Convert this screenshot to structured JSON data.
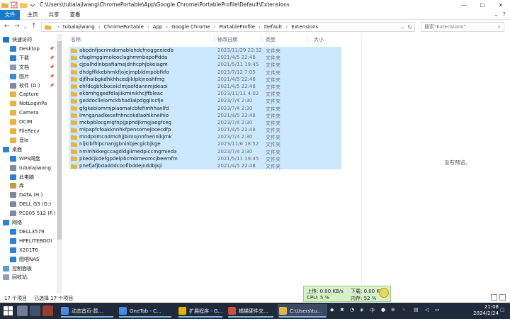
{
  "window": {
    "title": "C:\\Users\\tubalajiwang\\ChromePortable\\App\\Google Chrome\\PortableProfile\\Default\\Extensions"
  },
  "ribbon": {
    "tabs": [
      "文件",
      "主页",
      "共享",
      "查看"
    ]
  },
  "address": {
    "breadcrumbs": [
      "tubalajiwang",
      "ChromePortable",
      "App",
      "Google Chrome",
      "PortableProfile",
      "Default",
      "Extensions"
    ],
    "search_placeholder": "搜索\"Extensions\""
  },
  "sidebar": {
    "items": [
      {
        "label": "快速访问",
        "icon": "star-icon",
        "pinned": false
      },
      {
        "label": "Desktop",
        "icon": "desktop-icon",
        "pinned": true
      },
      {
        "label": "下载",
        "icon": "download-icon",
        "pinned": true
      },
      {
        "label": "文档",
        "icon": "document-icon",
        "pinned": true
      },
      {
        "label": "图片",
        "icon": "picture-icon",
        "pinned": true
      },
      {
        "label": "软件 (D:)",
        "icon": "drive-icon",
        "pinned": true
      },
      {
        "label": "Capture",
        "icon": "folder-icon",
        "pinned": false
      },
      {
        "label": "NotLoginPa",
        "icon": "folder-icon",
        "pinned": false
      },
      {
        "label": "Camera",
        "icon": "folder-icon",
        "pinned": false
      },
      {
        "label": "DCIM",
        "icon": "folder-icon",
        "pinned": false
      },
      {
        "label": "FileRecv",
        "icon": "folder-icon",
        "pinned": false
      },
      {
        "label": "音le",
        "icon": "folder-icon",
        "pinned": false
      },
      {
        "label": "桌面",
        "icon": "desktop-icon",
        "pinned": false
      },
      {
        "label": "WPS网盘",
        "icon": "cloud-icon",
        "pinned": false
      },
      {
        "label": "tubalajiwang",
        "icon": "user-icon",
        "pinned": false
      },
      {
        "label": "此电脑",
        "icon": "computer-icon",
        "pinned": false
      },
      {
        "label": "库",
        "icon": "library-icon",
        "pinned": false
      },
      {
        "label": "DATA (H:)",
        "icon": "drive-icon",
        "pinned": false
      },
      {
        "label": "DELL G3 (G:)",
        "icon": "drive-icon",
        "pinned": false
      },
      {
        "label": "PC005 512 (F:)",
        "icon": "drive-icon",
        "pinned": false
      },
      {
        "label": "网络",
        "icon": "network-icon",
        "pinned": false
      },
      {
        "label": "DELL3579",
        "icon": "computer-icon",
        "pinned": false
      },
      {
        "label": "HPELITEBOOI",
        "icon": "computer-icon",
        "pinned": false
      },
      {
        "label": "X201T6",
        "icon": "computer-icon",
        "pinned": false
      },
      {
        "label": "图吧NAS",
        "icon": "computer-icon",
        "pinned": false
      },
      {
        "label": "控制面板",
        "icon": "control-panel-icon",
        "pinned": false
      },
      {
        "label": "回收站",
        "icon": "recycle-bin-icon",
        "pinned": false
      }
    ]
  },
  "list": {
    "columns": {
      "name": "名称",
      "date": "修改日期",
      "type": "类型",
      "size": "大小"
    },
    "rows": [
      {
        "name": "abpdnfjocnmdomablahdcfnoggeeiedb",
        "date": "2023/11/29 22:32",
        "type": "文件夹"
      },
      {
        "name": "cfaglmggimoleoclaghmmbopoffdda",
        "date": "2021/4/5 22:48",
        "type": "文件夹"
      },
      {
        "name": "cjpalhdlnbpafiamejdnhcphjbkeiagm",
        "date": "2021/5/11 19:45",
        "type": "文件夹"
      },
      {
        "name": "dhdgffkkebhmkfjojejmpbldmpobfkfo",
        "date": "2023/7/12 7:05",
        "type": "文件夹"
      },
      {
        "name": "djflhoibgkdhkhhcedjiklpkjnoahfmg",
        "date": "2021/4/5 22:48",
        "type": "文件夹"
      },
      {
        "name": "ehfdcgbfcboceiclmjaofdannmjdeaoi",
        "date": "2021/4/5 22:48",
        "type": "文件夹"
      },
      {
        "name": "ekbmhggedfdlajiikminikhcjffbleac",
        "date": "2023/11/11 4:02",
        "type": "文件夹"
      },
      {
        "name": "geddoclleiomckbhadiaipdggiiccfje",
        "date": "2023/7/4 2:30",
        "type": "文件夹"
      },
      {
        "name": "gfgkebiommjpiaomalcbfefimhhanlfd",
        "date": "2023/7/4 2:30",
        "type": "文件夹"
      },
      {
        "name": "lmnganadkecefnhncokdlaohlkneihio",
        "date": "2021/4/5 22:48",
        "type": "文件夹"
      },
      {
        "name": "mcbpblocgmgfnpjjppndjkmgjaogfceg",
        "date": "2023/7/4 2:30",
        "type": "文件夹"
      },
      {
        "name": "mlpapfcfoakknnhkfpencomejbcecdfp",
        "date": "2021/4/5 22:48",
        "type": "文件夹"
      },
      {
        "name": "mndpomcndmohjjbimojnnfnennikjmk",
        "date": "2023/7/4 2:30",
        "type": "文件夹"
      },
      {
        "name": "nljkibfhlpcnanjgbnlnbjecgicbjkge",
        "date": "2023/11/6 18:52",
        "type": "文件夹"
      },
      {
        "name": "nmmhkkegccagdldgiimedpiccmgmieda",
        "date": "2023/7/4 2:30",
        "type": "文件夹"
      },
      {
        "name": "pkedcjkdefgpdelpbcmbmeomcjbeemfm",
        "date": "2021/5/11 19:45",
        "type": "文件夹"
      },
      {
        "name": "pnefjafjbdadddcooflbddejnddbjkji",
        "date": "2021/4/5 22:48",
        "type": "文件夹"
      }
    ]
  },
  "preview": {
    "message": "没有预览。"
  },
  "status": {
    "count": "17 个项目",
    "selected": "已选择 17 个项目"
  },
  "netmon": {
    "upload": "上传: 0.00 KB/s",
    "download": "下载: 0.00 KB/s",
    "cpu": "CPU: 5 %",
    "memory": "内存: 52 %"
  },
  "taskbar": {
    "tasks": [
      {
        "label": "动态首页-葬...",
        "color": "#4a8be0"
      },
      {
        "label": "OneTab - C...",
        "color": "#4a8be0"
      },
      {
        "label": "扩展程序 - G...",
        "color": "#e6b400"
      },
      {
        "label": "橘猫硬件交...",
        "color": "#d14f3f"
      },
      {
        "label": "C:\\Users\\tu...",
        "color": "#e8b341"
      }
    ],
    "time": "21:08",
    "date": "2024/2/24"
  }
}
